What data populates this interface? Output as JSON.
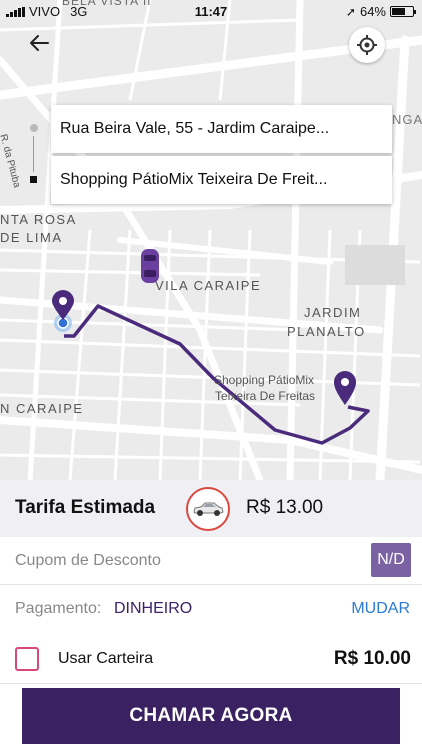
{
  "status_bar": {
    "carrier": "VIVO",
    "network": "3G",
    "time": "11:47",
    "battery": "64%",
    "battery_level": 0.64
  },
  "map": {
    "labels": {
      "bela_vista": "BELA VISTA II",
      "rua_pituba": "R. da Pituba",
      "santa_rosa_1": "NTA ROSA",
      "santa_rosa_2": "DE LIMA",
      "vila_caraipe": "VILA CARAIPE",
      "jardim_1": "JARDIM",
      "jardim_2": "PLANALTO",
      "shopping_1": "Shopping PátioMix",
      "shopping_2": "Teixeira De Freitas",
      "caraipe_left": "N CARAIPE",
      "nga": "NGA"
    },
    "route_color": "#4a2a7a",
    "pin_color": "#4a2a7a",
    "car_color": "#6a3fa0"
  },
  "route": {
    "origin": "Rua Beira Vale, 55 - Jardim Caraipe...",
    "destination": "Shopping PátioMix Teixeira De Freit..."
  },
  "fare": {
    "label": "Tarifa Estimada",
    "value": "R$ 13.00"
  },
  "coupon": {
    "label": "Cupom de Desconto",
    "badge": "N/D"
  },
  "payment": {
    "label": "Pagamento:",
    "method": "DINHEIRO",
    "change": "MUDAR"
  },
  "wallet": {
    "label": "Usar Carteira",
    "value": "R$ 10.00",
    "checked": false
  },
  "cta": {
    "label": "CHAMAR AGORA"
  },
  "colors": {
    "brand_purple": "#3a2262",
    "badge_purple": "#7b63a3",
    "link_blue": "#2a7bd5",
    "checkbox_pink": "#d9487a",
    "car_ring_red": "#d9493f"
  }
}
